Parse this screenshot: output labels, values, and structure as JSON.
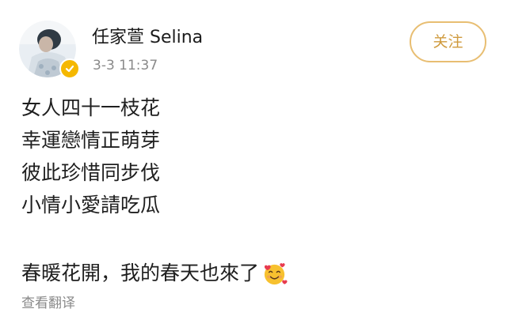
{
  "post": {
    "author": {
      "name": "任家萱 Selina",
      "avatar_icon": "avatar-photo",
      "verified_icon": "verified-badge-icon",
      "verified_color": "#f5b800"
    },
    "time": "3-3 11:37",
    "follow_label": "关注",
    "accent_color": "#cf9a3d",
    "lines": [
      "女人四十一枝花",
      "幸運戀情正萌芽",
      "彼此珍惜同步伐",
      "小情小愛請吃瓜"
    ],
    "closing_text": "春暖花開，我的春天也來了",
    "closing_emoji_icon": "smiling-face-with-hearts-icon",
    "translate_label": "查看翻译"
  }
}
